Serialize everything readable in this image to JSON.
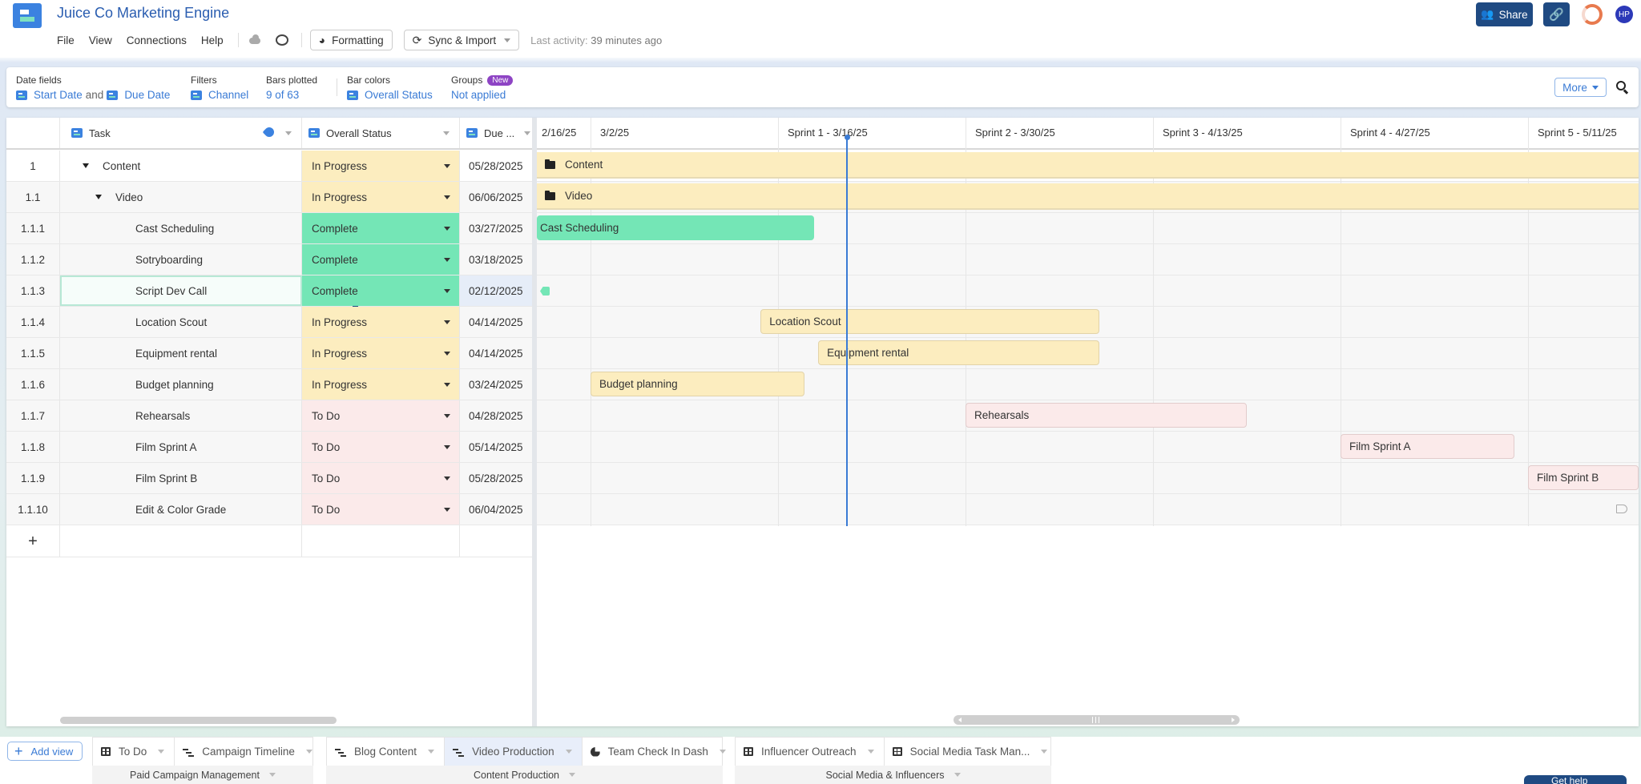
{
  "app": {
    "title": "Juice Co Marketing Engine",
    "menu": [
      "File",
      "View",
      "Connections",
      "Help"
    ],
    "formatting_label": "Formatting",
    "sync_label": "Sync & Import",
    "last_activity_label": "Last activity:",
    "last_activity_value": "39 minutes ago",
    "share_label": "Share",
    "avatar_initials": "HP",
    "icons": {
      "logo": "app-logo-icon",
      "cloud": "cloud-icon",
      "comment": "comment-icon",
      "formatting": "palette-icon",
      "sync": "sync-icon",
      "share": "users-icon",
      "link": "link-icon",
      "progress": "progress-ring-icon"
    }
  },
  "settings": {
    "date_fields_label": "Date fields",
    "start_date": "Start Date",
    "and_text": "and",
    "due_date": "Due Date",
    "filters_label": "Filters",
    "filter_value": "Channel",
    "bars_plotted_label": "Bars plotted",
    "bars_plotted_value": "9 of 63",
    "bar_colors_label": "Bar colors",
    "bar_colors_value": "Overall Status",
    "groups_label": "Groups",
    "groups_badge": "New",
    "groups_value": "Not applied",
    "more_label": "More"
  },
  "grid": {
    "columns": {
      "task": "Task",
      "status": "Overall Status",
      "due": "Due ..."
    },
    "rows": [
      {
        "num": "1",
        "task": "Content",
        "status": "In Progress",
        "due": "05/28/2025",
        "level": 0,
        "expandable": true
      },
      {
        "num": "1.1",
        "task": "Video",
        "status": "In Progress",
        "due": "06/06/2025",
        "level": 1,
        "expandable": true
      },
      {
        "num": "1.1.1",
        "task": "Cast Scheduling",
        "status": "Complete",
        "due": "03/27/2025",
        "level": 2
      },
      {
        "num": "1.1.2",
        "task": "Sotryboarding",
        "status": "Complete",
        "due": "03/18/2025",
        "level": 2
      },
      {
        "num": "1.1.3",
        "task": "Script Dev Call",
        "status": "Complete",
        "due": "02/12/2025",
        "level": 2,
        "selected": true
      },
      {
        "num": "1.1.4",
        "task": "Location Scout",
        "status": "In Progress",
        "due": "04/14/2025",
        "level": 2
      },
      {
        "num": "1.1.5",
        "task": "Equipment rental",
        "status": "In Progress",
        "due": "04/14/2025",
        "level": 2
      },
      {
        "num": "1.1.6",
        "task": "Budget planning",
        "status": "In Progress",
        "due": "03/24/2025",
        "level": 2
      },
      {
        "num": "1.1.7",
        "task": "Rehearsals",
        "status": "To Do",
        "due": "04/28/2025",
        "level": 2
      },
      {
        "num": "1.1.8",
        "task": "Film Sprint A",
        "status": "To Do",
        "due": "05/14/2025",
        "level": 2
      },
      {
        "num": "1.1.9",
        "task": "Film Sprint B",
        "status": "To Do",
        "due": "05/28/2025",
        "level": 2
      },
      {
        "num": "1.1.10",
        "task": "Edit & Color Grade",
        "status": "To Do",
        "due": "06/04/2025",
        "level": 2
      }
    ],
    "add_row_label": "+"
  },
  "status_colors": {
    "In Progress": "#fcedbf",
    "Complete": "#74e6b6",
    "To Do": "#fbeaea"
  },
  "gantt": {
    "ticks": [
      "2/16/25",
      "3/2/25",
      "Sprint 1 - 3/16/25",
      "Sprint 2 - 3/30/25",
      "Sprint 3 - 4/13/25",
      "Sprint 4 - 4/27/25",
      "Sprint 5 - 5/11/25"
    ],
    "today": "Sprint 1 - 3/16/25 +3d",
    "bars": [
      {
        "label": "Content",
        "type": "summary"
      },
      {
        "label": "Video",
        "type": "summary"
      },
      {
        "label": "Cast Scheduling",
        "type": "complete"
      },
      {
        "label": "",
        "type": "none"
      },
      {
        "label": "",
        "type": "milestone"
      },
      {
        "label": "Location Scout",
        "type": "progress"
      },
      {
        "label": "Equipment rental",
        "type": "progress"
      },
      {
        "label": "Budget planning",
        "type": "progress"
      },
      {
        "label": "Rehearsals",
        "type": "todo"
      },
      {
        "label": "Film Sprint A",
        "type": "todo"
      },
      {
        "label": "Film Sprint B",
        "type": "todo"
      },
      {
        "label": "",
        "type": "offscreen"
      }
    ]
  },
  "views": {
    "add_view_label": "Add view",
    "groups": [
      {
        "name": "Paid Campaign Management",
        "tabs": [
          {
            "label": "To Do",
            "icon": "table-icon"
          },
          {
            "label": "Campaign Timeline",
            "icon": "gantt-icon"
          }
        ]
      },
      {
        "name": "Content Production",
        "tabs": [
          {
            "label": "Blog Content",
            "icon": "gantt-icon"
          },
          {
            "label": "Video Production",
            "icon": "gantt-icon",
            "active": true
          },
          {
            "label": "Team Check In Dash",
            "icon": "dashboard-icon"
          }
        ]
      },
      {
        "name": "Social Media & Influencers",
        "tabs": [
          {
            "label": "Influencer Outreach",
            "icon": "table-icon"
          },
          {
            "label": "Social Media Task Man...",
            "icon": "table-icon"
          }
        ]
      }
    ],
    "get_help_label": "Get help"
  }
}
